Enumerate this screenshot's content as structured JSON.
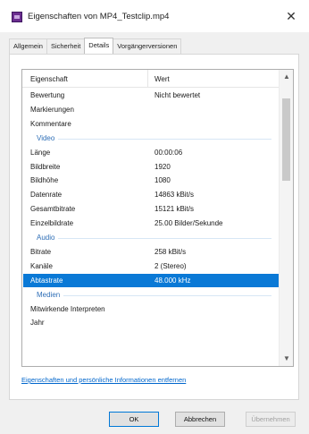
{
  "window": {
    "title": "Eigenschaften von MP4_Testclip.mp4",
    "close_glyph": "✕"
  },
  "tabs": [
    {
      "label": "Allgemein"
    },
    {
      "label": "Sicherheit"
    },
    {
      "label": "Details",
      "active": true
    },
    {
      "label": "Vorgängerversionen"
    }
  ],
  "table": {
    "col_property": "Eigenschaft",
    "col_value": "Wert",
    "rows": [
      {
        "type": "item",
        "key": "Bewertung",
        "value": "Nicht bewertet"
      },
      {
        "type": "item",
        "key": "Markierungen",
        "value": ""
      },
      {
        "type": "item",
        "key": "Kommentare",
        "value": ""
      },
      {
        "type": "group",
        "key": "Video"
      },
      {
        "type": "item",
        "key": "Länge",
        "value": "00:00:06"
      },
      {
        "type": "item",
        "key": "Bildbreite",
        "value": "1920"
      },
      {
        "type": "item",
        "key": "Bildhöhe",
        "value": "1080"
      },
      {
        "type": "item",
        "key": "Datenrate",
        "value": "14863 kBit/s"
      },
      {
        "type": "item",
        "key": "Gesamtbitrate",
        "value": "15121 kBit/s"
      },
      {
        "type": "item",
        "key": "Einzelbildrate",
        "value": "25.00 Bilder/Sekunde"
      },
      {
        "type": "group",
        "key": "Audio"
      },
      {
        "type": "item",
        "key": "Bitrate",
        "value": "258 kBit/s"
      },
      {
        "type": "item",
        "key": "Kanäle",
        "value": "2 (Stereo)"
      },
      {
        "type": "item",
        "key": "Abtastrate",
        "value": "48.000 kHz",
        "selected": true
      },
      {
        "type": "group",
        "key": "Medien"
      },
      {
        "type": "item",
        "key": "Mitwirkende Interpreten",
        "value": ""
      },
      {
        "type": "item",
        "key": "Jahr",
        "value": ""
      }
    ]
  },
  "link_text": "Eigenschaften und persönliche Informationen entfernen",
  "buttons": {
    "ok": "OK",
    "cancel": "Abbrechen",
    "apply": "Übernehmen"
  },
  "colors": {
    "selection": "#0a79d6",
    "group_header": "#2f6fb7",
    "link": "#0066cc"
  }
}
